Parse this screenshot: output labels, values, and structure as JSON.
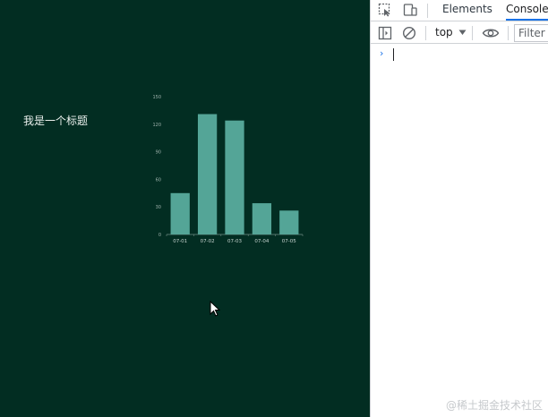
{
  "page": {
    "title": "我是一个标题",
    "background": "#022d22"
  },
  "chart_data": {
    "type": "bar",
    "categories": [
      "07-01",
      "07-02",
      "07-03",
      "07-04",
      "07-05"
    ],
    "values": [
      45,
      131,
      124,
      34,
      26
    ],
    "ylim": [
      0,
      150
    ],
    "yticks": [
      "0",
      "30",
      "60",
      "90",
      "120",
      "150"
    ],
    "grid": false,
    "bar_color": "#54a597"
  },
  "devtools": {
    "tabs": [
      {
        "label": "Elements",
        "active": false
      },
      {
        "label": "Console",
        "active": true
      }
    ],
    "toolbar": {
      "context": "top",
      "filter_placeholder": "Filter"
    },
    "console": {
      "prompt": "›"
    },
    "icons": [
      "inspect-icon",
      "device-toggle-icon",
      "sidebar-toggle-icon",
      "clear-console-icon",
      "dropdown-arrow-icon",
      "eye-icon"
    ]
  },
  "watermark": "@稀土掘金技术社区",
  "accent": "#1a73e8"
}
